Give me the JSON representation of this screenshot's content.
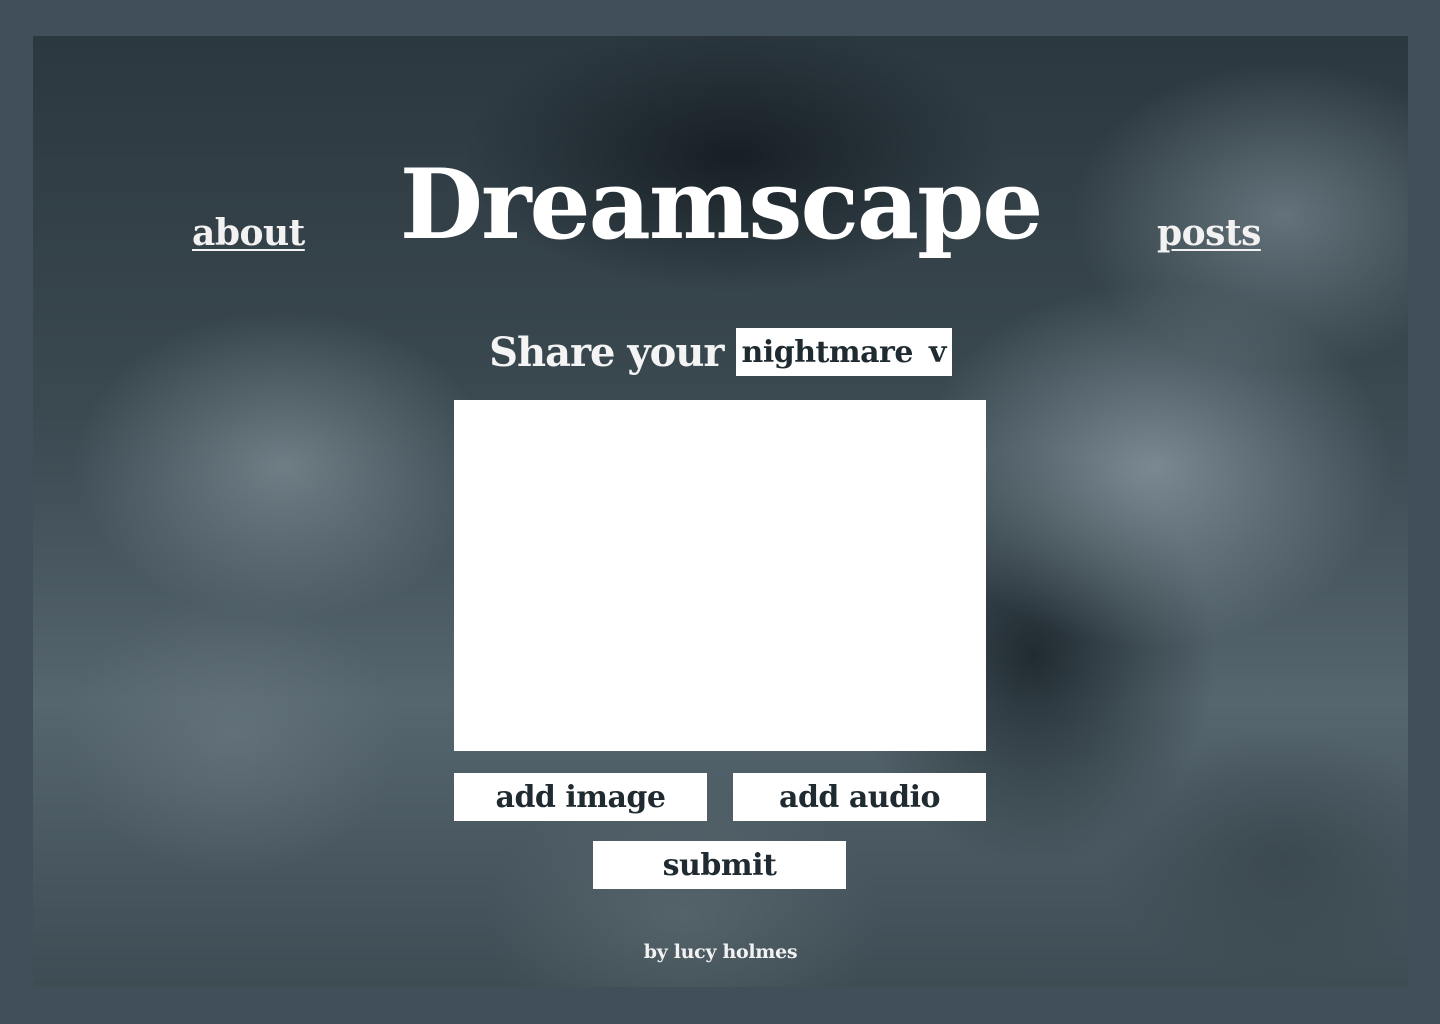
{
  "nav": {
    "about_label": "about",
    "posts_label": "posts"
  },
  "header": {
    "title": "Dreamscape"
  },
  "form": {
    "share_label": "Share your",
    "dream_type": {
      "selected": "nightmare",
      "arrow": "v"
    },
    "text_value": "",
    "add_image_label": "add image",
    "add_audio_label": "add audio",
    "submit_label": "submit"
  },
  "footer": {
    "credit": "by lucy holmes"
  },
  "colors": {
    "outer_border": "#404f59",
    "text_light": "#ffffff",
    "text_dark": "#1f2b31",
    "field_bg": "#ffffff"
  }
}
